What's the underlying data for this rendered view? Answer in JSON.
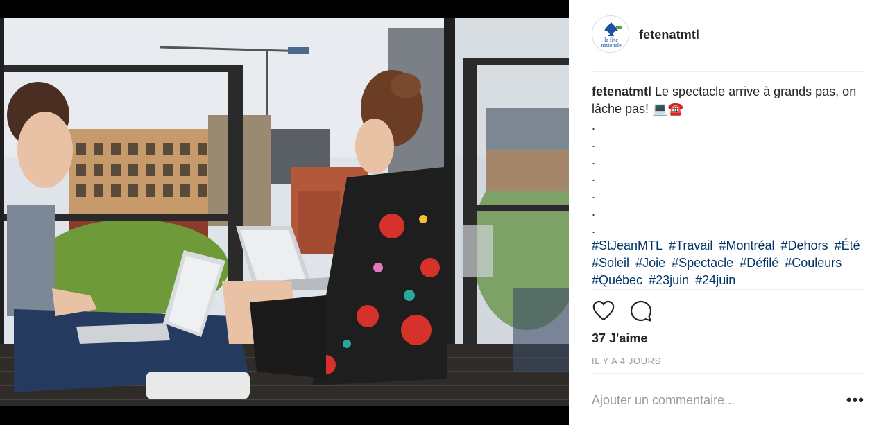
{
  "post": {
    "username": "fetenatmtl",
    "caption": {
      "username": "fetenatmtl",
      "text": "Le spectacle arrive à grands pas, on lâche pas! 💻☎️",
      "dots": [
        ".",
        ".",
        ".",
        ".",
        ".",
        ".",
        "."
      ],
      "hashtags": [
        "#StJeanMTL",
        "#Travail",
        "#Montréal",
        "#Dehors",
        "#Été",
        "#Soleil",
        "#Joie",
        "#Spectacle",
        "#Défilé",
        "#Couleurs",
        "#Québec",
        "#23juin",
        "#24juin"
      ]
    },
    "likes": "37 J'aime",
    "timestamp": "IL Y A 4 JOURS",
    "comment_placeholder": "Ajouter un commentaire...",
    "more_label": "•••"
  },
  "avatar_logo": {
    "line1": "la fête",
    "line2": "nationale"
  },
  "icons": {
    "like": "heart-icon",
    "comment": "comment-bubble-icon",
    "more": "more-options-icon"
  },
  "colors": {
    "hashtag": "#003569",
    "text": "#262626",
    "muted": "#999999",
    "divider": "#efefef"
  }
}
